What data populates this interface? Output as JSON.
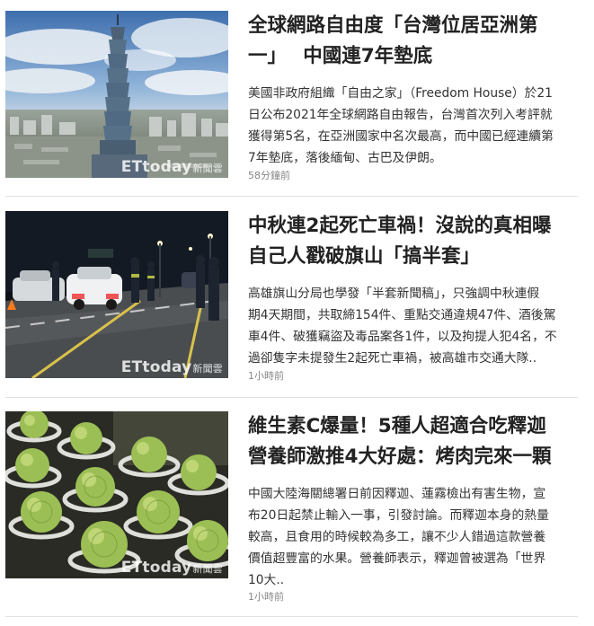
{
  "colors": {
    "title": "#222222",
    "summary": "#333333",
    "time": "#888888",
    "divider": "#e2e2e2"
  },
  "watermark": {
    "brand": "ETtoday",
    "suffix": "新聞雲"
  },
  "articles": [
    {
      "title_lines": [
        "全球網路自由度「台灣位居亞洲第",
        "一」　 中國連7年墊底"
      ],
      "summary_lines": [
        "美國非政府組織「自由之家」（Freedom House）於21",
        "日公布2021年全球網路自由報告，台灣首次列入考評就",
        "獲得第5名，在亞洲國家中名次最高，而中國已經連續第",
        "7年墊底，落後緬甸、古巴及伊朗。"
      ],
      "time": "58分鐘前",
      "thumb_icon": "taipei-101-skyline-photo"
    },
    {
      "title_lines": [
        "中秋連2起死亡車禍！沒說的真相曝",
        "自己人戳破旗山「搞半套」"
      ],
      "summary_lines": [
        "高雄旗山分局也學發「半套新聞稿」，只強調中秋連假",
        "期4天期間，共取締154件、重點交通違規47件、酒後駕",
        "車4件、破獲竊盜及毒品案各1件，以及拘提人犯4名，不",
        "過卻隻字未提發生2起死亡車禍，被高雄市交通大隊.."
      ],
      "time": "1小時前",
      "thumb_icon": "police-checkpoint-night-photo"
    },
    {
      "title_lines": [
        "維生素C爆量！5種人超適合吃釋迦",
        "營養師激推4大好處：烤肉完來一顆"
      ],
      "summary_lines": [
        "中國大陸海關總署日前因釋迦、蓮霧檢出有害生物，宣",
        "布20日起禁止輸入一事，引發討論。而釋迦本身的熱量",
        "較高，且食用的時候較為多工，讓不少人錯過這款營養",
        "價值超豐富的水果。營養師表示，釋迦曾被選為「世界",
        "10大.."
      ],
      "time": "1小時前",
      "thumb_icon": "sugar-apple-fruit-photo"
    }
  ]
}
